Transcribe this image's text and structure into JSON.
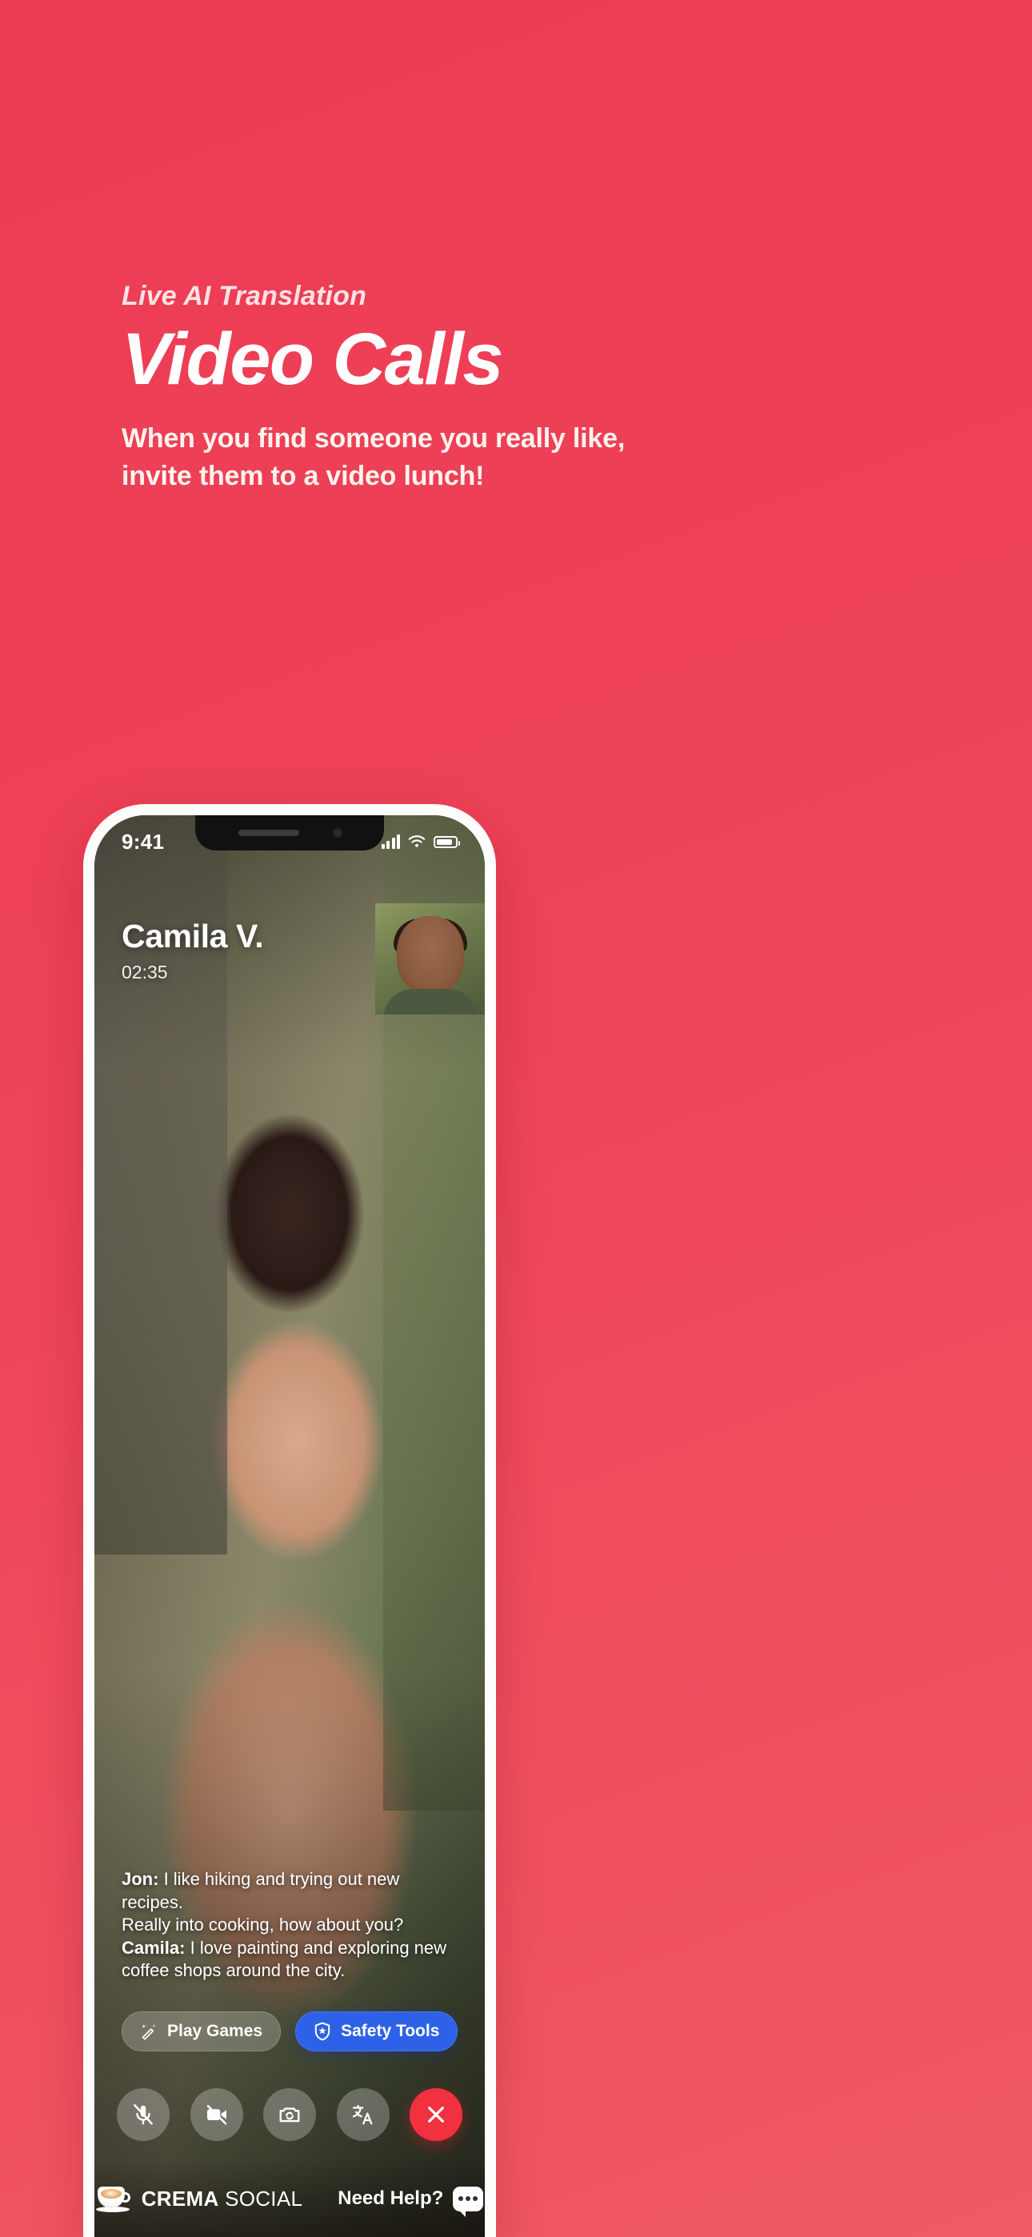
{
  "poster": {
    "background_color": "#ee4057",
    "eyebrow": "Live AI Translation",
    "title": "Video Calls",
    "subtitle_line1": "When you find someone you really like,",
    "subtitle_line2": "invite them to a video lunch!"
  },
  "phone": {
    "status_bar": {
      "time": "9:41",
      "cellular_icon": "signal-bars-icon",
      "wifi_icon": "wifi-icon",
      "battery_icon": "battery-icon"
    },
    "call": {
      "caller_name": "Camila V.",
      "duration": "02:35",
      "self_view_label": "self-view"
    },
    "captions": [
      {
        "speaker": "Jon:",
        "text": " I like hiking and trying out new recipes."
      },
      {
        "speaker": "",
        "text": "Really into cooking, how about you?"
      },
      {
        "speaker": "Camila:",
        "text": " I love painting and exploring new"
      },
      {
        "speaker": "",
        "text": "coffee shops around the city."
      }
    ],
    "pills": [
      {
        "label": "Play Games",
        "icon": "magic-wand-icon",
        "style": "glass"
      },
      {
        "label": "Safety Tools",
        "icon": "shield-star-icon",
        "style": "primary",
        "color": "#2d62e8"
      }
    ],
    "controls": [
      {
        "name": "mic-off-button",
        "icon": "microphone-slash-icon"
      },
      {
        "name": "video-off-button",
        "icon": "video-slash-icon"
      },
      {
        "name": "flip-camera-button",
        "icon": "camera-flip-icon"
      },
      {
        "name": "translate-button",
        "icon": "translate-icon"
      },
      {
        "name": "end-call-button",
        "icon": "close-x-icon",
        "color": "#f1313f"
      }
    ],
    "footer": {
      "brand_bold": "CREMA",
      "brand_light": " SOCIAL",
      "brand_icon": "coffee-cup-icon",
      "help_label": "Need Help?",
      "help_icon": "chat-bubble-icon"
    }
  }
}
